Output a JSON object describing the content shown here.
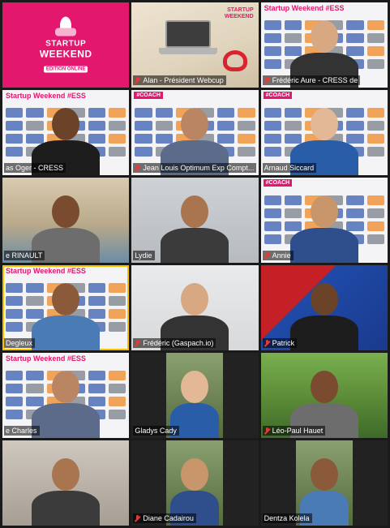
{
  "tiles": [
    {
      "name": "",
      "muted": false,
      "bg": "bg-pink",
      "type": "logo"
    },
    {
      "name": "Alan - Président Webcup",
      "muted": true,
      "bg": "bg-desk",
      "type": "desk"
    },
    {
      "name": "Frédéric Aure - CRESS de",
      "muted": true,
      "bg": "bg-banner",
      "type": "banner-person"
    },
    {
      "name": "as Oger - CRESS",
      "muted": false,
      "bg": "bg-banner",
      "type": "banner-person"
    },
    {
      "name": "Jean Louis Optimum Exp Compt...",
      "muted": true,
      "bg": "bg-banner",
      "type": "banner-person",
      "coach": true
    },
    {
      "name": "Arnaud Siccard",
      "muted": false,
      "bg": "bg-banner",
      "type": "banner-person",
      "coach": true
    },
    {
      "name": "e RINAULT",
      "muted": false,
      "bg": "bg-room1",
      "type": "person"
    },
    {
      "name": "Lydie",
      "muted": false,
      "bg": "bg-room2",
      "type": "person"
    },
    {
      "name": "Annie",
      "muted": true,
      "bg": "bg-banner",
      "type": "banner-person",
      "coach": true
    },
    {
      "name": "Degleux",
      "muted": false,
      "bg": "bg-banner",
      "type": "banner-person",
      "active": true
    },
    {
      "name": "Frédéric (Gaspach.io)",
      "muted": true,
      "bg": "bg-room3",
      "type": "person"
    },
    {
      "name": "Patrick",
      "muted": true,
      "bg": "bg-ocean",
      "type": "person"
    },
    {
      "name": "e Charles",
      "muted": false,
      "bg": "bg-banner",
      "type": "banner-person"
    },
    {
      "name": "Gladys Cady",
      "muted": false,
      "bg": "bg-dark",
      "type": "person-narrow"
    },
    {
      "name": "Léo-Paul Hauet",
      "muted": true,
      "bg": "bg-green",
      "type": "person"
    },
    {
      "name": "",
      "muted": false,
      "bg": "bg-wall",
      "type": "person"
    },
    {
      "name": "Diane Cadairou",
      "muted": true,
      "bg": "bg-dark",
      "type": "person-narrow"
    },
    {
      "name": "Dentza Kolela",
      "muted": false,
      "bg": "bg-dark",
      "type": "person-narrow"
    }
  ],
  "logo": {
    "line1": "STARTUP",
    "line2": "WEEKEND",
    "line3": "EDITION ONLINE"
  },
  "banner": {
    "title": "Startup Weekend #ESS",
    "coach_tag": "#COACH"
  },
  "desk_logo": {
    "line1": "STARTUP",
    "line2": "WEEKEND"
  },
  "colors": {
    "brand_pink": "#e4176f",
    "muted_red": "#e23b3b",
    "active_border": "#f2c200"
  }
}
